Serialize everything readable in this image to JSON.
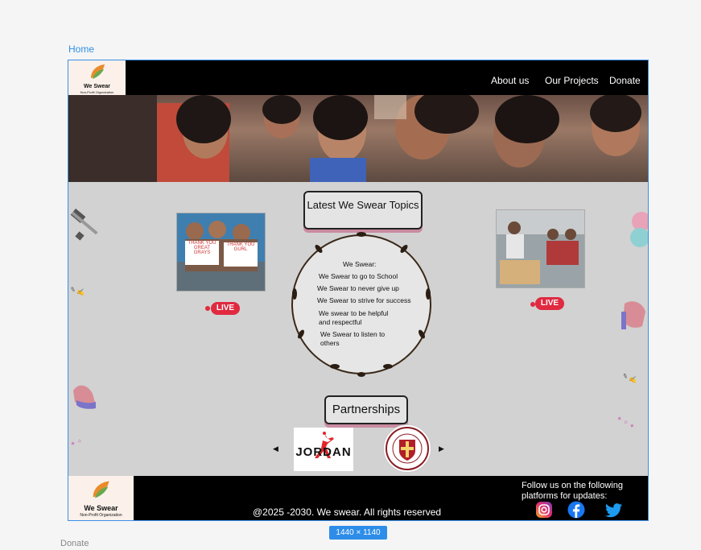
{
  "frame_label": "Home",
  "next_frame_label": "Donate",
  "size_badge": "1440 × 1140",
  "header": {
    "logo_title": "We Swear",
    "logo_subtitle": "Non-Profit Organization",
    "nav": [
      "About us",
      "Our Projects",
      "Donate"
    ]
  },
  "topics": {
    "heading": "Latest We Swear Topics",
    "live_label": "LIVE",
    "circle_lines": [
      "We Swear:",
      "We Swear to go to School",
      "We Swear to never give up",
      "We Swear to strive for success",
      "We swear to be helpful",
      "and respectful",
      "We Swear to listen to",
      "others"
    ],
    "sign_texts": [
      "THANK YOU",
      "GREAT GRAYS",
      "THANK YOU",
      "GURL"
    ]
  },
  "partnerships": {
    "heading": "Partnerships",
    "partner1": "JORDAN"
  },
  "footer": {
    "copyright": "@2025 -2030. We swear. All rights reserved",
    "follow_line1": "Follow us on the following",
    "follow_line2": "platforms for updates:",
    "logo_title": "We Swear",
    "logo_subtitle": "Non-Profit Organization"
  },
  "icons": [
    "instagram-icon",
    "facebook-icon",
    "twitter-icon",
    "left-arrow-icon",
    "right-arrow-icon"
  ],
  "colors": {
    "selection": "#3b8fe8",
    "live": "#e02a40",
    "facebook": "#1877f2",
    "twitter": "#1d9bf0"
  }
}
